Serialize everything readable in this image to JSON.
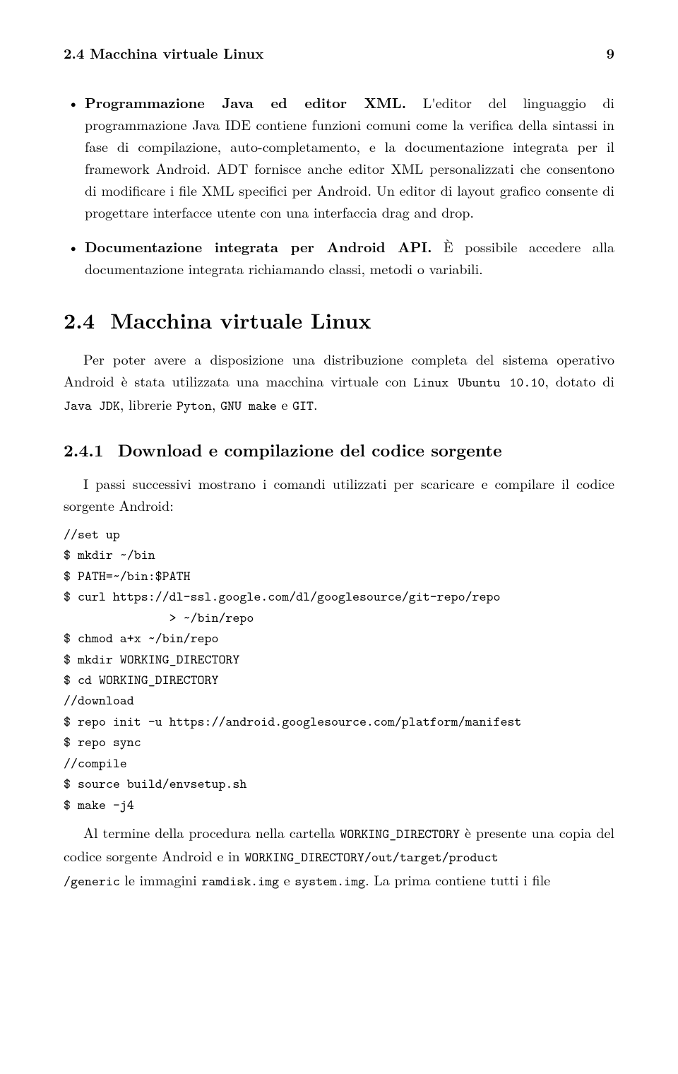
{
  "header": {
    "left": "2.4 Macchina virtuale Linux",
    "right": "9"
  },
  "bullets": [
    {
      "title": "Programmazione Java ed editor XML.",
      "body": " L'editor del linguaggio di programmazione Java IDE contiene funzioni comuni come la verifica della sintassi in fase di compilazione, auto-completamento, e la documentazione integrata per il framework Android. ADT fornisce anche editor XML personalizzati che consentono di modificare i file XML specifici per Android. Un editor di layout grafico consente di progettare interfacce utente con una interfaccia drag and drop."
    },
    {
      "title": "Documentazione integrata per Android API.",
      "body": " È possibile accedere alla documentazione integrata richiamando classi, metodi o variabili."
    }
  ],
  "section": {
    "num": "2.4",
    "title": "Macchina virtuale Linux",
    "p1a": "Per poter avere a disposizione una distribuzione completa del sistema operativo Android è stata utilizzata una macchina virtuale con ",
    "p1_tt1": "Linux Ubuntu 10.10",
    "p1b": ", dotato di ",
    "p1_tt2": "Java JDK",
    "p1c": ", librerie ",
    "p1_tt3": "Pyton",
    "p1d": ", ",
    "p1_tt4": "GNU make",
    "p1e": " e ",
    "p1_tt5": "GIT",
    "p1f": "."
  },
  "subsection": {
    "num": "2.4.1",
    "title": "Download e compilazione del codice sorgente",
    "intro": "I passi successivi mostrano i comandi utilizzati per scaricare e compilare il codice sorgente Android:"
  },
  "code": "//set up\n$ mkdir ~/bin\n$ PATH=~/bin:$PATH\n$ curl https://dl-ssl.google.com/dl/googlesource/git-repo/repo\n               > ~/bin/repo\n$ chmod a+x ~/bin/repo\n$ mkdir WORKING_DIRECTORY\n$ cd WORKING_DIRECTORY\n//download\n$ repo init -u https://android.googlesource.com/platform/manifest\n$ repo sync\n//compile\n$ source build/envsetup.sh\n$ make -j4",
  "closing": {
    "a": "Al termine della procedura nella cartella ",
    "tt1": "WORKING_DIRECTORY",
    "b": " è presente una copia del codice sorgente Android e in ",
    "tt2": "WORKING_DIRECTORY/out/target/product",
    "c_line2a": "/generic",
    "c_line2b": " le immagini ",
    "tt3": "ramdisk.img",
    "d": " e ",
    "tt4": "system.img",
    "e": ". La prima contiene tutti i file"
  }
}
